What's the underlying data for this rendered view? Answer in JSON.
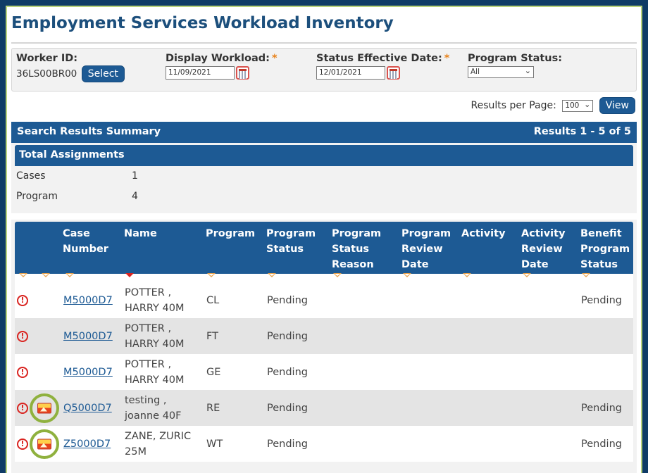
{
  "page": {
    "title": "Employment Services Workload Inventory"
  },
  "filters": {
    "worker_id": {
      "label": "Worker ID:",
      "value": "36LS00BR00",
      "button": "Select"
    },
    "display_workload": {
      "label": "Display Workload:",
      "required": "*",
      "value": "11/09/2021"
    },
    "status_effective_date": {
      "label": "Status Effective Date:",
      "required": "*",
      "value": "12/01/2021"
    },
    "program_status": {
      "label": "Program Status:",
      "value": "All"
    }
  },
  "results_per_page": {
    "label": "Results per Page:",
    "value": "100",
    "button": "View"
  },
  "summary": {
    "title": "Search Results Summary",
    "range": "Results 1 - 5 of 5"
  },
  "totals": {
    "title": "Total Assignments",
    "rows": [
      {
        "label": "Cases",
        "count": "1"
      },
      {
        "label": "Program",
        "count": "4"
      }
    ]
  },
  "table": {
    "headers": {
      "case_number": "Case\nNumber",
      "name": "Name",
      "program": "Program",
      "program_status": "Program\nStatus",
      "program_status_reason": "Program\nStatus\nReason",
      "program_review_date": "Program\nReview\nDate",
      "activity": "Activity",
      "activity_review_date": "Activity\nReview\nDate",
      "benefit_program_status": "Benefit\nProgram\nStatus"
    },
    "rows": [
      {
        "case": "M5000D7",
        "name": "POTTER ,\nHARRY 40M",
        "program": "CL",
        "status": "Pending",
        "benefit": "Pending",
        "image": false
      },
      {
        "case": "M5000D7",
        "name": "POTTER ,\nHARRY 40M",
        "program": "FT",
        "status": "Pending",
        "benefit": "",
        "image": false
      },
      {
        "case": "M5000D7",
        "name": "POTTER ,\nHARRY 40M",
        "program": "GE",
        "status": "Pending",
        "benefit": "",
        "image": false
      },
      {
        "case": "Q5000D7",
        "name": "testing ,\njoanne 40F",
        "program": "RE",
        "status": "Pending",
        "benefit": "Pending",
        "image": true
      },
      {
        "case": "Z5000D7",
        "name": "ZANE, ZURIC\n25M",
        "program": "WT",
        "status": "Pending",
        "benefit": "Pending",
        "image": true
      }
    ]
  },
  "icons": {
    "alert": "alert-circle-icon",
    "image": "image-icon",
    "calendar": "calendar-icon",
    "sort": "sort-arrow-icon"
  },
  "colors": {
    "header_blue": "#1d5a94",
    "title_blue": "#1c4f7c",
    "required_orange": "#e8831c",
    "alert_red": "#d9231f",
    "highlight_green": "#8fb13e"
  }
}
